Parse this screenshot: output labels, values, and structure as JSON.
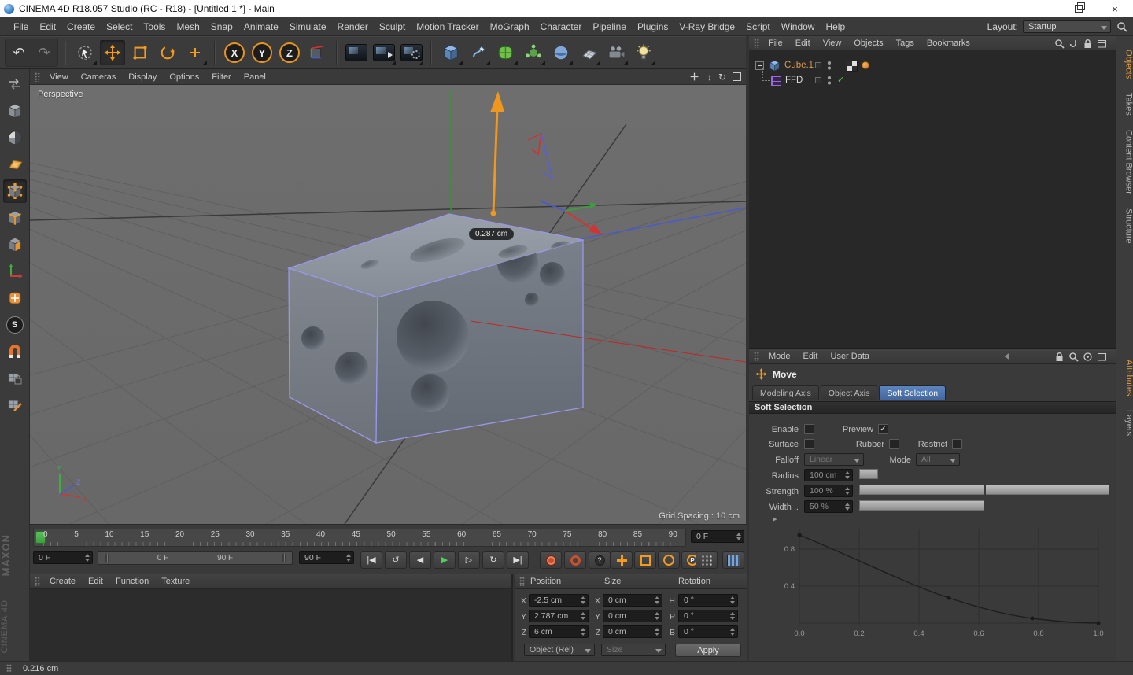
{
  "titlebar": {
    "title": "CINEMA 4D R18.057 Studio (RC - R18) - [Untitled 1 *] - Main",
    "close_glyph": "×"
  },
  "menubar": {
    "items": [
      "File",
      "Edit",
      "Create",
      "Select",
      "Tools",
      "Mesh",
      "Snap",
      "Animate",
      "Simulate",
      "Render",
      "Sculpt",
      "Motion Tracker",
      "MoGraph",
      "Character",
      "Pipeline",
      "Plugins",
      "V-Ray Bridge",
      "Script",
      "Window",
      "Help"
    ],
    "layout_label": "Layout:",
    "layout_value": "Startup"
  },
  "toolbar": {
    "undo_glyph": "↶",
    "redo_glyph": "↷",
    "axis_x": "X",
    "axis_y": "Y",
    "axis_z": "Z"
  },
  "left_toolbar": {
    "snap_letter": "S"
  },
  "viewport": {
    "menus": [
      "View",
      "Cameras",
      "Display",
      "Options",
      "Filter",
      "Panel"
    ],
    "camera_label": "Perspective",
    "measurement": "0.287 cm",
    "grid_spacing": "Grid Spacing : 10 cm",
    "nav": {
      "zoom": "↕",
      "orbit": "↻"
    },
    "axis_labels": {
      "x": "X",
      "y": "Y",
      "z": "Z"
    }
  },
  "timeline": {
    "ticks": [
      "0",
      "5",
      "10",
      "15",
      "20",
      "25",
      "30",
      "35",
      "40",
      "45",
      "50",
      "55",
      "60",
      "65",
      "70",
      "75",
      "80",
      "85",
      "90"
    ],
    "current_frame": "0 F",
    "start_frame": "0 F",
    "range_start": "0 F",
    "range_end": "90 F",
    "end_frame": "90 F",
    "transport": {
      "goto_start": "|◀",
      "loop_back": "↺",
      "prev": "◀",
      "play": "▶",
      "next": "▷",
      "loop": "↻",
      "goto_end": "▶|"
    },
    "help_glyph": "?",
    "record_parameter": "P"
  },
  "material_manager": {
    "menus": [
      "Create",
      "Edit",
      "Function",
      "Texture"
    ]
  },
  "branding": {
    "maxon": "MAXON",
    "cinema": "CINEMA 4D"
  },
  "coordinates": {
    "headers": [
      "Position",
      "Size",
      "Rotation"
    ],
    "position": {
      "labels": [
        "X",
        "Y",
        "Z"
      ],
      "values": [
        "-2.5 cm",
        "2.787 cm",
        "6 cm"
      ]
    },
    "size": {
      "labels": [
        "X",
        "Y",
        "Z"
      ],
      "values": [
        "0 cm",
        "0 cm",
        "0 cm"
      ]
    },
    "rotation": {
      "labels": [
        "H",
        "P",
        "B"
      ],
      "values": [
        "0 °",
        "0 °",
        "0 °"
      ]
    },
    "mode_dropdown": "Object (Rel)",
    "size_dropdown": "Size",
    "apply_button": "Apply"
  },
  "object_manager": {
    "menus": [
      "File",
      "Edit",
      "View",
      "Objects",
      "Tags",
      "Bookmarks"
    ],
    "objects": [
      {
        "name": "Cube.1"
      },
      {
        "name": "FFD",
        "enabled": "✓"
      }
    ]
  },
  "attributes": {
    "menus": [
      "Mode",
      "Edit",
      "User Data"
    ],
    "tool_name": "Move",
    "tabs": [
      "Modeling Axis",
      "Object Axis",
      "Soft Selection"
    ],
    "active_tab": "Soft Selection",
    "section_title": "Soft Selection",
    "rows": {
      "enable_label": "Enable",
      "preview_label": "Preview",
      "preview_checked": "✓",
      "surface_label": "Surface",
      "rubber_label": "Rubber",
      "restrict_label": "Restrict",
      "falloff_label": "Falloff",
      "falloff_value": "Linear",
      "mode_label": "Mode",
      "mode_value": "All",
      "radius_label": "Radius",
      "radius_value": "100 cm",
      "strength_label": "Strength",
      "strength_value": "100 %",
      "width_label": "Width ..",
      "width_value": "50 %",
      "expander": "▸"
    },
    "falloff_curve": {
      "type": "line",
      "x_ticks": [
        "0.0",
        "0.2",
        "0.4",
        "0.6",
        "0.8",
        "1.0"
      ],
      "y_ticks": [
        "0.8",
        "0.4"
      ],
      "points": [
        [
          0.0,
          0.95
        ],
        [
          0.5,
          0.27
        ],
        [
          0.78,
          0.05
        ],
        [
          1.0,
          0.0
        ]
      ]
    }
  },
  "right_tabs": {
    "top": [
      "Objects",
      "Takes",
      "Content Browser",
      "Structure"
    ],
    "bottom": [
      "Attributes",
      "Layers"
    ]
  },
  "statusbar": {
    "value": "0.216 cm"
  }
}
